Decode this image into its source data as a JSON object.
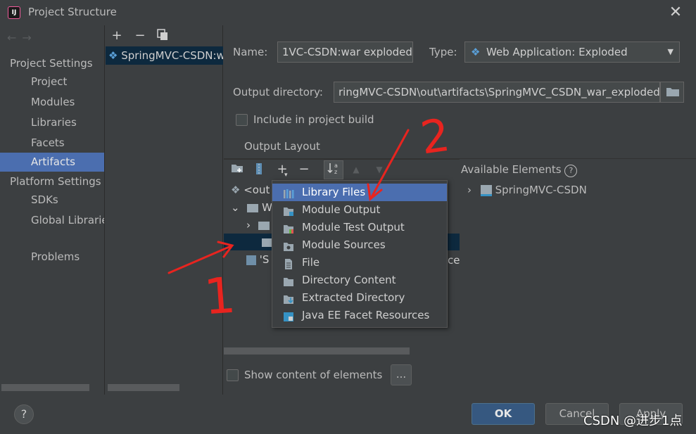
{
  "window": {
    "title": "Project Structure",
    "app_icon_text": "IJ"
  },
  "nav": {
    "project_settings": "Project Settings",
    "project": "Project",
    "modules": "Modules",
    "libraries": "Libraries",
    "facets": "Facets",
    "artifacts": "Artifacts",
    "platform_settings": "Platform Settings",
    "sdks": "SDKs",
    "global_libraries": "Global Libraries",
    "problems": "Problems"
  },
  "artifacts_list": {
    "selected": "SpringMVC-CSDN:war exploded"
  },
  "form": {
    "name_label": "Name:",
    "name_value": "1VC-CSDN:war exploded",
    "type_label": "Type:",
    "type_value": "Web Application: Exploded",
    "output_dir_label": "Output directory:",
    "output_dir_value": "ringMVC-CSDN\\out\\artifacts\\SpringMVC_CSDN_war_exploded",
    "include_build_label": "Include in project build",
    "output_layout_label": "Output Layout",
    "available_elements_label": "Available Elements",
    "available_root": "SpringMVC-CSDN",
    "show_content_label": "Show content of elements",
    "ellipsis": "..."
  },
  "tree": {
    "row_root": "<out",
    "row_w": "W",
    "row_s": "'S",
    "row_s_suffix": "ce"
  },
  "popup_menu": {
    "items": [
      {
        "label": "Library Files",
        "icon": "library-icon"
      },
      {
        "label": "Module Output",
        "icon": "module-output-icon"
      },
      {
        "label": "Module Test Output",
        "icon": "module-test-output-icon"
      },
      {
        "label": "Module Sources",
        "icon": "module-sources-icon"
      },
      {
        "label": "File",
        "icon": "file-icon"
      },
      {
        "label": "Directory Content",
        "icon": "directory-icon"
      },
      {
        "label": "Extracted Directory",
        "icon": "extracted-directory-icon"
      },
      {
        "label": "Java EE Facet Resources",
        "icon": "javaee-icon"
      }
    ],
    "selected_index": 0
  },
  "buttons": {
    "ok": "OK",
    "cancel": "Cancel",
    "apply": "Apply",
    "help": "?"
  },
  "annotations": {
    "mark_1": "1",
    "mark_2": "2"
  },
  "watermark": "CSDN @进步1点",
  "colors": {
    "accent": "#4b6eaf",
    "selection_dark": "#0d293e",
    "annotation": "#e8241f",
    "ok_button": "#365880"
  }
}
